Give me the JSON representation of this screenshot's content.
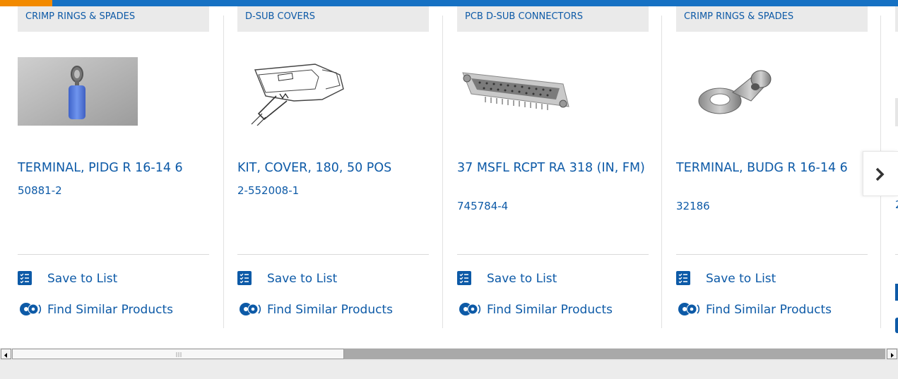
{
  "colors": {
    "accent_blue": "#1671c3",
    "accent_orange": "#f28a00",
    "link_blue": "#0d5aa7",
    "category_bg": "#eaeaea"
  },
  "carousel": {
    "cards": [
      {
        "category": "CRIMP RINGS & SPADES",
        "title": "TERMINAL, PIDG R 16-14 6",
        "part_number": "50881-2",
        "image": "blue-ring-terminal-photo",
        "save_label": "Save to List",
        "similar_label": "Find Similar Products"
      },
      {
        "category": "D-SUB COVERS",
        "title": "KIT, COVER, 180, 50 POS",
        "part_number": "2-552008-1",
        "image": "dsub-cover-drawing",
        "save_label": "Save to List",
        "similar_label": "Find Similar Products"
      },
      {
        "category": "PCB D-SUB CONNECTORS",
        "title": "37 MSFL RCPT RA 318 (IN, FM)",
        "part_number": "745784-4",
        "image": "pcb-dsub-connector-photo",
        "save_label": "Save to List",
        "similar_label": "Find Similar Products"
      },
      {
        "category": "CRIMP RINGS & SPADES",
        "title": "TERMINAL, BUDG R 16-14 6",
        "part_number": "32186",
        "image": "ring-terminal-photo",
        "save_label": "Save to List",
        "similar_label": "Find Similar Products"
      }
    ],
    "partial_card_part_number": "2"
  },
  "icons": {
    "save": "checklist-icon",
    "similar": "gears-icon",
    "next": "chevron-right-icon"
  }
}
